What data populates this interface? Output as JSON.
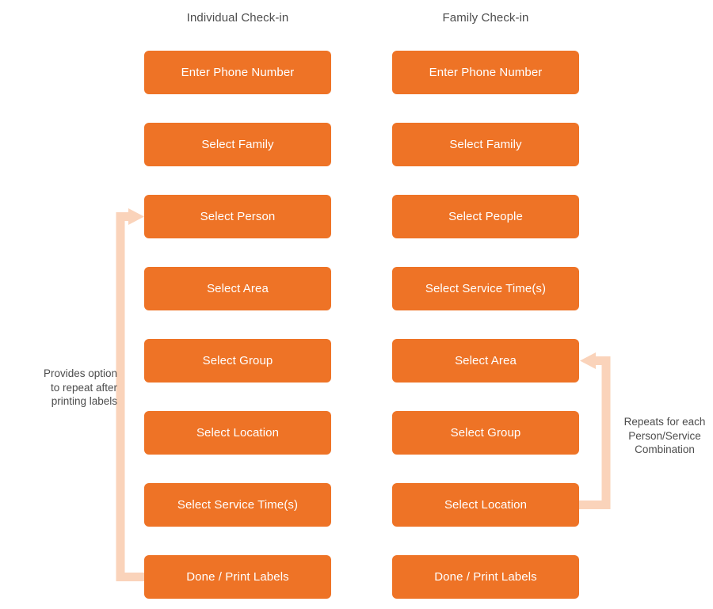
{
  "diagram": {
    "title_left": "Individual Check-in",
    "title_right": "Family Check-in",
    "colors": {
      "box_fill": "#ee7326",
      "box_text": "#ffffff",
      "arrow": "#fad3ba",
      "label_text": "#4d4d4d",
      "background": "#ffffff"
    }
  },
  "columns": [
    {
      "id": "individual-check-in",
      "heading": "Individual Check-in",
      "steps": [
        {
          "label": "Enter Phone Number"
        },
        {
          "label": "Select Family"
        },
        {
          "label": "Select Person"
        },
        {
          "label": "Select Area"
        },
        {
          "label": "Select Group"
        },
        {
          "label": "Select Location"
        },
        {
          "label": "Select Service Time(s)"
        },
        {
          "label": "Done / Print Labels"
        }
      ]
    },
    {
      "id": "family-check-in",
      "heading": "Family Check-in",
      "steps": [
        {
          "label": "Enter Phone Number"
        },
        {
          "label": "Select Family"
        },
        {
          "label": "Select People"
        },
        {
          "label": "Select Service Time(s)"
        },
        {
          "label": "Select Area"
        },
        {
          "label": "Select Group"
        },
        {
          "label": "Select Location"
        },
        {
          "label": "Done / Print Labels"
        }
      ]
    }
  ],
  "loops": [
    {
      "id": "individual-repeat-loop",
      "note": "Provides option\nto repeat after\nprinting labels",
      "note_line1": "Provides option",
      "note_line2": "to repeat after",
      "note_line3": "printing labels",
      "from_step": "Done / Print Labels",
      "to_step": "Select Person"
    },
    {
      "id": "family-repeat-loop",
      "note": "Repeats for each\nPerson/Service\nCombination",
      "note_line1": "Repeats for each",
      "note_line2": "Person/Service",
      "note_line3": "Combination",
      "from_step": "Select Location",
      "to_step": "Select Area"
    }
  ]
}
